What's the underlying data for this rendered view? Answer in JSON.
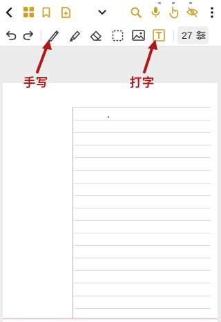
{
  "topbar": {
    "icons": [
      "back-chevron-icon",
      "grid-icon",
      "bookmark-icon",
      "add-page-icon",
      "chevron-down-icon",
      "search-icon",
      "microphone-icon",
      "touch-hand-icon",
      "eye-off-icon",
      "more-vertical-icon"
    ]
  },
  "toolbar": {
    "icons": [
      "undo-icon",
      "redo-icon",
      "pen-icon",
      "highlighter-icon",
      "eraser-icon",
      "lasso-select-icon",
      "image-icon",
      "text-box-icon",
      "settings-sliders-icon"
    ],
    "font_size": "27"
  },
  "annotations": {
    "handwriting_label": "手写",
    "typing_label": "打字"
  },
  "colors": {
    "accent": "#c9a227",
    "annotation": "#b01818",
    "icon": "#333333",
    "canvas": "#ececec"
  }
}
